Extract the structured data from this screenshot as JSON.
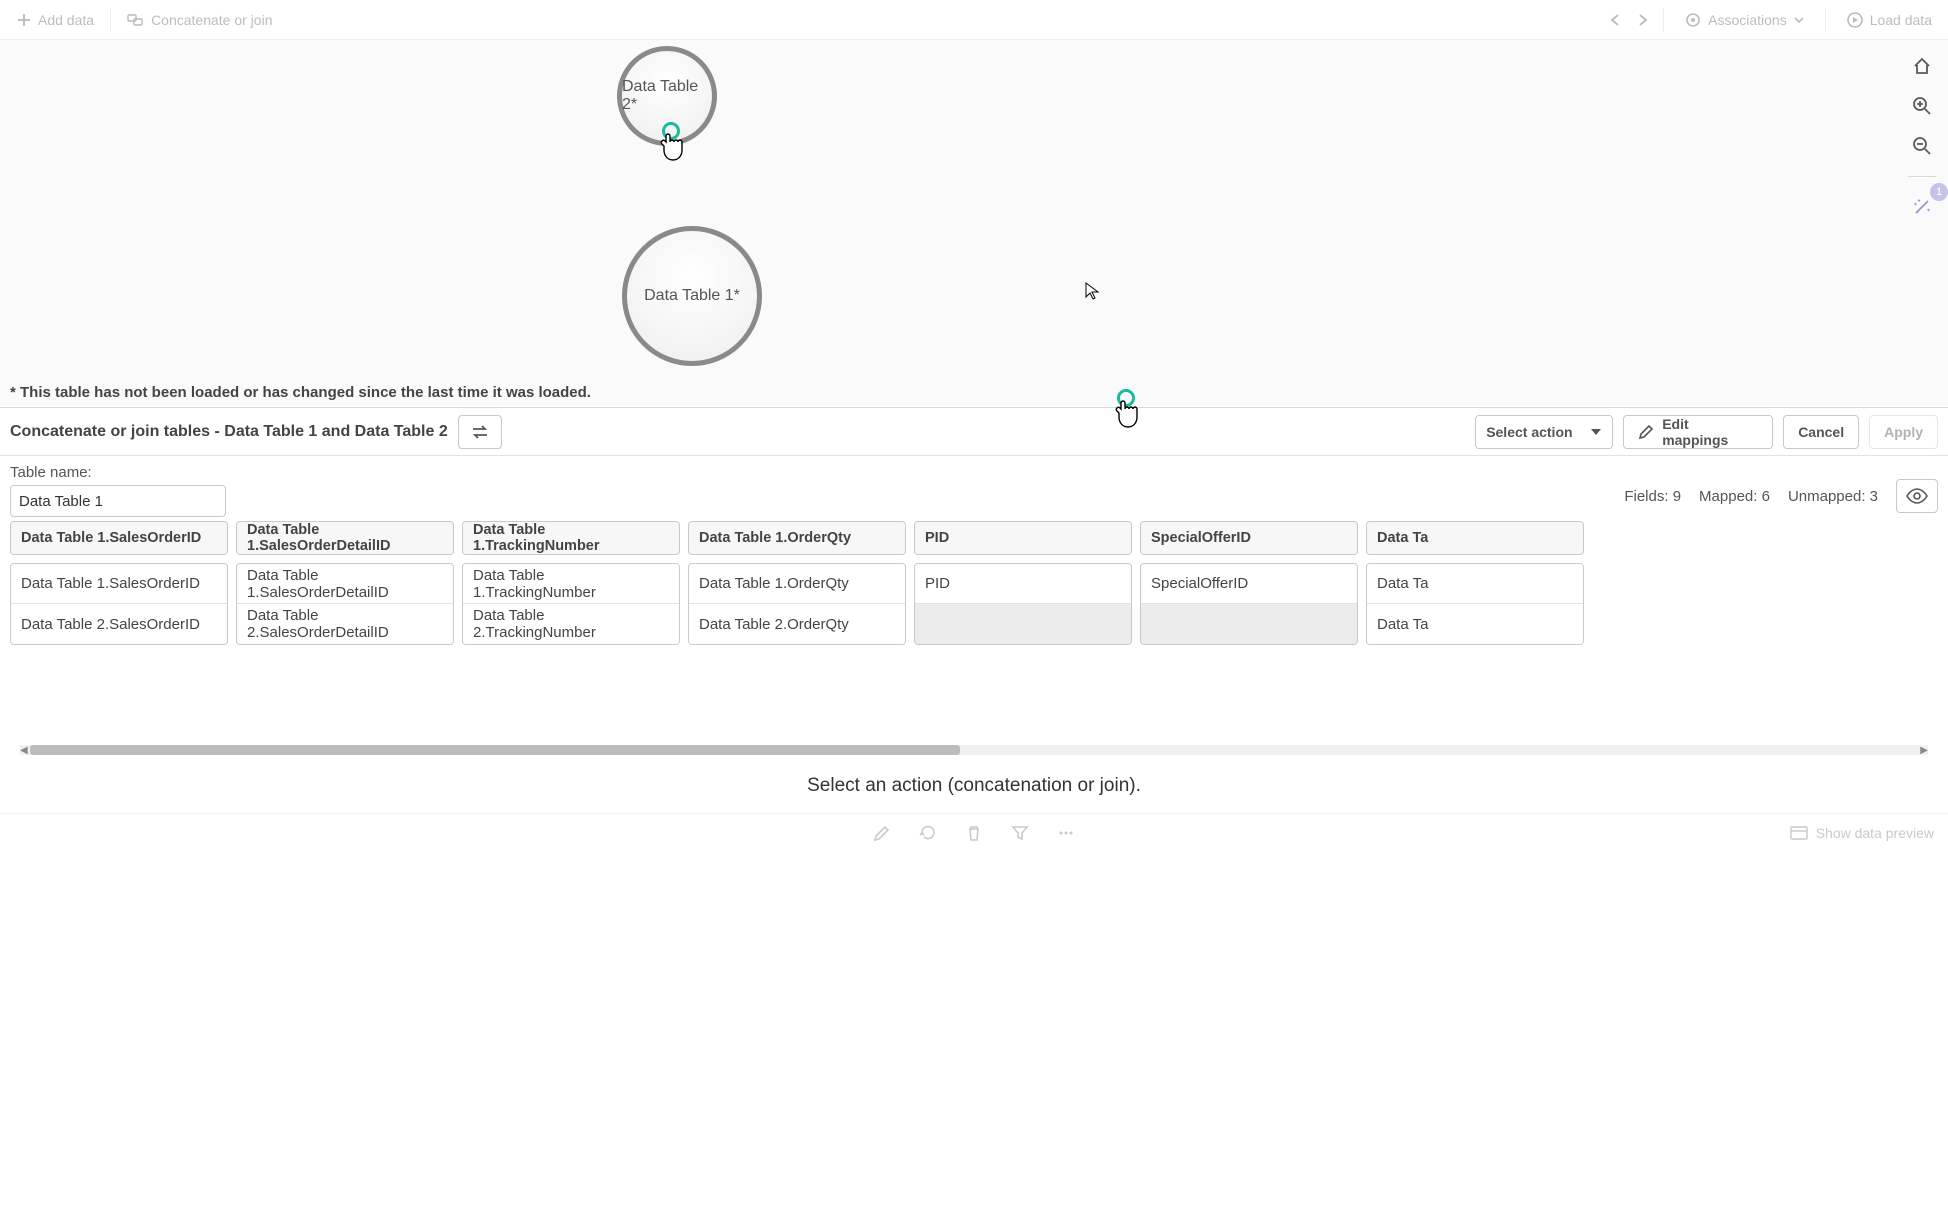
{
  "toolbar": {
    "add_data": "Add data",
    "concat_join": "Concatenate or join",
    "associations": "Associations",
    "load_data": "Load data"
  },
  "canvas": {
    "node1_label": "Data Table 2*",
    "node2_label": "Data Table 1*",
    "note": "* This table has not been loaded or has changed since the last time it was loaded."
  },
  "right_tools": {
    "badge_count": "1"
  },
  "action_bar": {
    "title": "Concatenate or join tables - Data Table 1 and Data Table 2",
    "select_action": "Select action",
    "edit_mappings": "Edit mappings",
    "cancel": "Cancel",
    "apply": "Apply"
  },
  "table_name": {
    "label": "Table name:",
    "value": "Data Table 1"
  },
  "stats": {
    "fields": "Fields: 9",
    "mapped": "Mapped: 6",
    "unmapped": "Unmapped: 3"
  },
  "columns": [
    {
      "header": "Data Table 1.SalesOrderID",
      "row1": "Data Table 1.SalesOrderID",
      "row2": "Data Table 2.SalesOrderID",
      "row2_empty": false
    },
    {
      "header": "Data Table 1.SalesOrderDetailID",
      "row1": "Data Table 1.SalesOrderDetailID",
      "row2": "Data Table 2.SalesOrderDetailID",
      "row2_empty": false
    },
    {
      "header": "Data Table 1.TrackingNumber",
      "row1": "Data Table 1.TrackingNumber",
      "row2": "Data Table 2.TrackingNumber",
      "row2_empty": false
    },
    {
      "header": "Data Table 1.OrderQty",
      "row1": "Data Table 1.OrderQty",
      "row2": "Data Table 2.OrderQty",
      "row2_empty": false
    },
    {
      "header": "PID",
      "row1": "PID",
      "row2": "",
      "row2_empty": true
    },
    {
      "header": "SpecialOfferID",
      "row1": "SpecialOfferID",
      "row2": "",
      "row2_empty": true
    },
    {
      "header": "Data Ta",
      "row1": "Data Ta",
      "row2": "Data Ta",
      "row2_empty": false
    }
  ],
  "hint": "Select an action (concatenation or join).",
  "bottom": {
    "show_preview": "Show data preview"
  }
}
